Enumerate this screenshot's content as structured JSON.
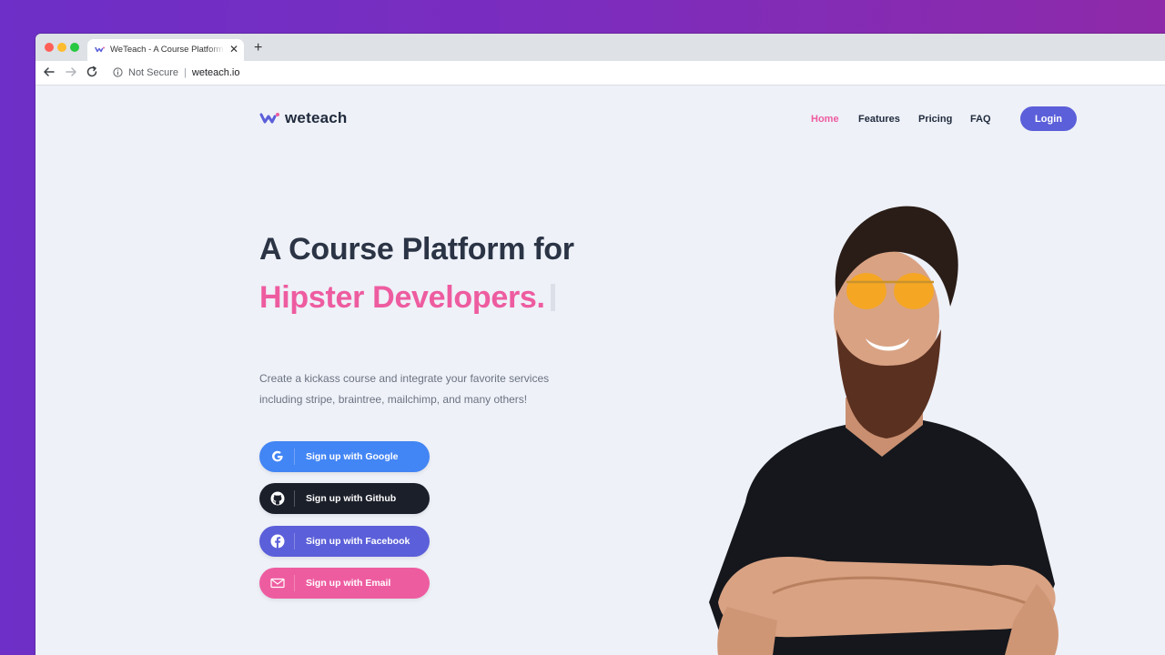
{
  "browser": {
    "tab_title": "WeTeach - A Course Platform for Hipster Developers",
    "tab_close": "✕",
    "new_tab": "+",
    "security_label": "Not Secure",
    "separator": "|",
    "url": "weteach.io"
  },
  "header": {
    "logo_text": "weteach",
    "nav": [
      {
        "label": "Home",
        "active": true
      },
      {
        "label": "Features",
        "active": false
      },
      {
        "label": "Pricing",
        "active": false
      },
      {
        "label": "FAQ",
        "active": false
      }
    ],
    "login_label": "Login"
  },
  "hero": {
    "headline_line1": "A Course Platform for",
    "headline_line2": "Hipster Developers.",
    "subtitle_line1": "Create a kickass course and integrate your favorite services",
    "subtitle_line2": "including stripe, braintree, mailchimp, and many others!"
  },
  "signup_buttons": [
    {
      "label": "Sign up with Google",
      "icon": "google-icon",
      "color": "#4285f4"
    },
    {
      "label": "Sign up with Github",
      "icon": "github-icon",
      "color": "#1b1f2a"
    },
    {
      "label": "Sign up with Facebook",
      "icon": "facebook-icon",
      "color": "#5b5fd9"
    },
    {
      "label": "Sign up with Email",
      "icon": "envelope-icon",
      "color": "#ee5ca0"
    }
  ],
  "colors": {
    "accent_pink": "#ee5ca0",
    "accent_purple": "#5b5fd9",
    "text_dark": "#1f2a3c",
    "page_bg": "#eef1f8"
  }
}
